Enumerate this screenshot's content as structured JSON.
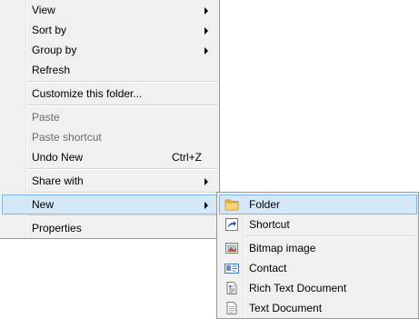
{
  "context_menu": {
    "items": [
      {
        "label": "View",
        "submenu": true
      },
      {
        "label": "Sort by",
        "submenu": true
      },
      {
        "label": "Group by",
        "submenu": true
      },
      {
        "label": "Refresh"
      },
      {
        "label": "Customize this folder..."
      },
      {
        "label": "Paste",
        "disabled": true
      },
      {
        "label": "Paste shortcut",
        "disabled": true
      },
      {
        "label": "Undo New",
        "shortcut": "Ctrl+Z"
      },
      {
        "label": "Share with",
        "submenu": true
      },
      {
        "label": "New",
        "submenu": true,
        "highlighted": true
      },
      {
        "label": "Properties"
      }
    ]
  },
  "new_submenu": {
    "items": [
      {
        "label": "Folder",
        "icon": "folder-icon",
        "highlighted": true
      },
      {
        "label": "Shortcut",
        "icon": "shortcut-icon"
      },
      {
        "label": "Bitmap image",
        "icon": "bitmap-image-icon"
      },
      {
        "label": "Contact",
        "icon": "contact-card-icon"
      },
      {
        "label": "Rich Text Document",
        "icon": "rich-text-document-icon"
      },
      {
        "label": "Text Document",
        "icon": "text-document-icon"
      }
    ]
  },
  "colors": {
    "menu_background": "#f0f0f0",
    "highlight_fill": "#d5e8f7",
    "highlight_border": "#7eb4ea",
    "disabled_text": "#6d6d6d"
  }
}
